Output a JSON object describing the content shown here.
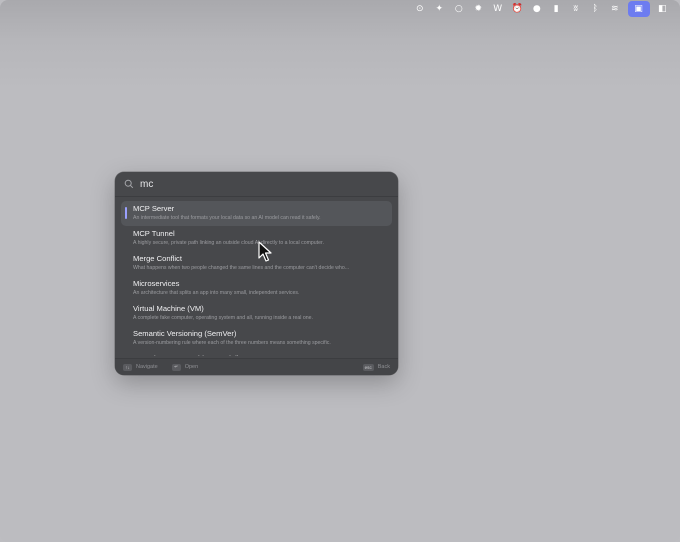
{
  "menubar": {
    "icons": [
      {
        "name": "target-icon",
        "glyph": "⊙"
      },
      {
        "name": "sparkle-icon",
        "glyph": "✦"
      },
      {
        "name": "circle-outline-icon",
        "glyph": "○"
      },
      {
        "name": "sun-icon",
        "glyph": "✹"
      },
      {
        "name": "w-app-icon",
        "glyph": "W"
      },
      {
        "name": "alarm-clock-icon",
        "glyph": "⏰"
      },
      {
        "name": "record-dot-icon",
        "glyph": "●"
      },
      {
        "name": "battery-icon",
        "glyph": "▮"
      },
      {
        "name": "mute-icon",
        "glyph": "ʬ"
      },
      {
        "name": "bluetooth-icon",
        "glyph": "ᛒ"
      },
      {
        "name": "wifi-icon",
        "glyph": "≋"
      },
      {
        "name": "folder-user-icon",
        "glyph": "▣"
      },
      {
        "name": "control-center-icon",
        "glyph": "◧"
      }
    ],
    "accent": "#6d7cf0"
  },
  "search": {
    "value": "mc",
    "placeholder": ""
  },
  "results": [
    {
      "title": "MCP Server",
      "desc": "An intermediate tool that formats your local data so an AI model can read it safely."
    },
    {
      "title": "MCP Tunnel",
      "desc": "A highly secure, private path linking an outside cloud AI directly to a local computer."
    },
    {
      "title": "Merge Conflict",
      "desc": "What happens when two people changed the same lines and the computer can't decide who..."
    },
    {
      "title": "Microservices",
      "desc": "An architecture that splits an app into many small, independent services."
    },
    {
      "title": "Virtual Machine (VM)",
      "desc": "A complete fake computer, operating system and all, running inside a real one."
    },
    {
      "title": "Semantic Versioning (SemVer)",
      "desc": "A version-numbering rule where each of the three numbers means something specific."
    },
    {
      "title": "DOM (Document Object Model)",
      "desc": ""
    }
  ],
  "footer": {
    "navigate_key": "↑↓",
    "navigate_label": "Navigate",
    "open_key": "↵",
    "open_label": "Open",
    "back_key": "esc",
    "back_label": "Back"
  }
}
